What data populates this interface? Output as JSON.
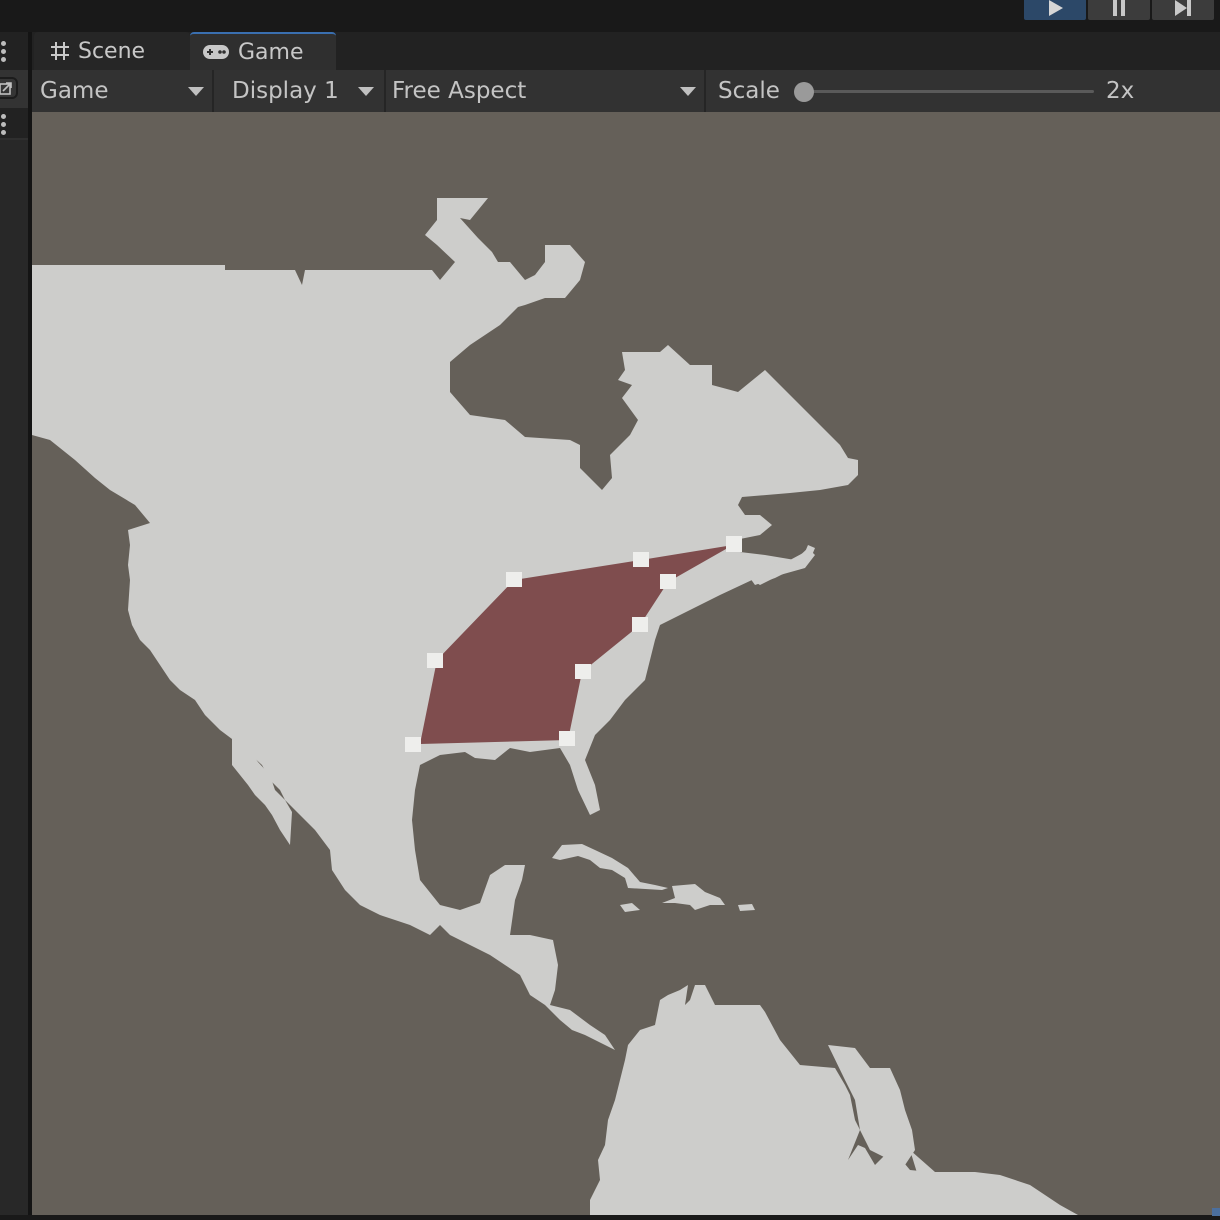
{
  "window": {
    "play_controls": [
      {
        "name": "play",
        "icon": "play-icon",
        "active": true
      },
      {
        "name": "pause",
        "icon": "pause-icon",
        "active": false
      },
      {
        "name": "step",
        "icon": "step-icon",
        "active": false
      }
    ]
  },
  "tabs": [
    {
      "label": "Scene",
      "icon": "grid-hash-icon",
      "active": false
    },
    {
      "label": "Game",
      "icon": "gamepad-icon",
      "active": true
    }
  ],
  "toolbar": {
    "view_mode": "Game",
    "display": "Display 1",
    "aspect": "Free Aspect",
    "scale_label": "Scale",
    "scale_value": "2x",
    "scale_slider_fraction": 0.0
  },
  "viewport": {
    "background_color": "#656059",
    "land_color": "#cdcdcb",
    "region": {
      "fill_color": "#7c4849",
      "handle_color": "#eeeeec",
      "handle_count": 9
    }
  },
  "colors": {
    "accent": "#2c4868",
    "tab_active_line": "#3a6fb0"
  }
}
